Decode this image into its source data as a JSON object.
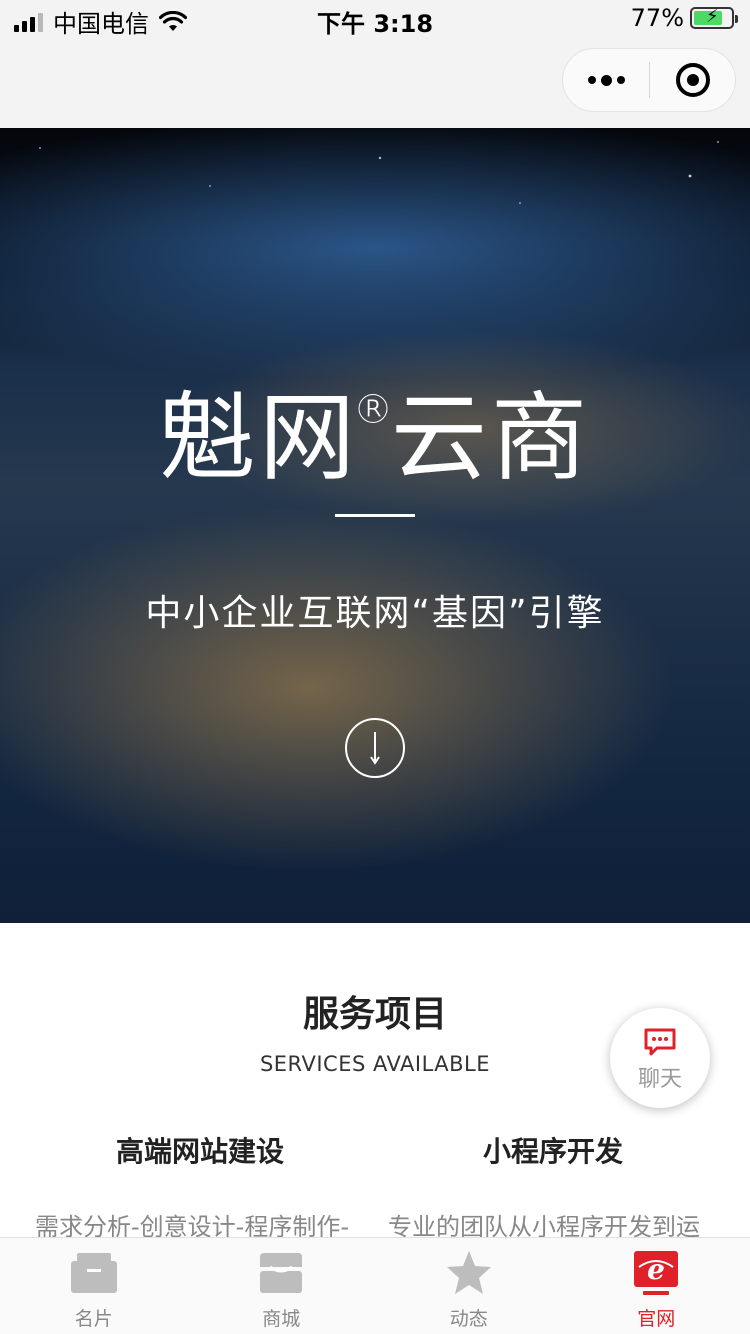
{
  "status_bar": {
    "carrier": "中国电信",
    "time": "下午 3:18",
    "battery": "77%",
    "battery_level": 0.77
  },
  "nav": {
    "more_icon": "more-dots-icon",
    "close_icon": "target-icon"
  },
  "hero": {
    "title_part1": "魁网",
    "registered": "®",
    "title_part2": "云商",
    "subtitle": "中小企业互联网“基因”引擎",
    "scroll_icon": "arrow-down-icon"
  },
  "services": {
    "title": "服务项目",
    "subtitle": "SERVICES AVAILABLE",
    "items": [
      {
        "name": "高端网站建设",
        "desc": "需求分析-创意设计-程序制作-"
      },
      {
        "name": "小程序开发",
        "desc": "专业的团队从小程序开发到运"
      }
    ]
  },
  "chat": {
    "label": "聊天",
    "icon": "chat-bubble-icon"
  },
  "tabs": [
    {
      "label": "名片",
      "icon": "card-icon",
      "active": false
    },
    {
      "label": "商城",
      "icon": "shop-icon",
      "active": false
    },
    {
      "label": "动态",
      "icon": "star-icon",
      "active": false
    },
    {
      "label": "官网",
      "icon": "ie-icon",
      "active": true
    }
  ],
  "colors": {
    "accent": "#e0212a",
    "tab_inactive": "#bdbdbd"
  }
}
